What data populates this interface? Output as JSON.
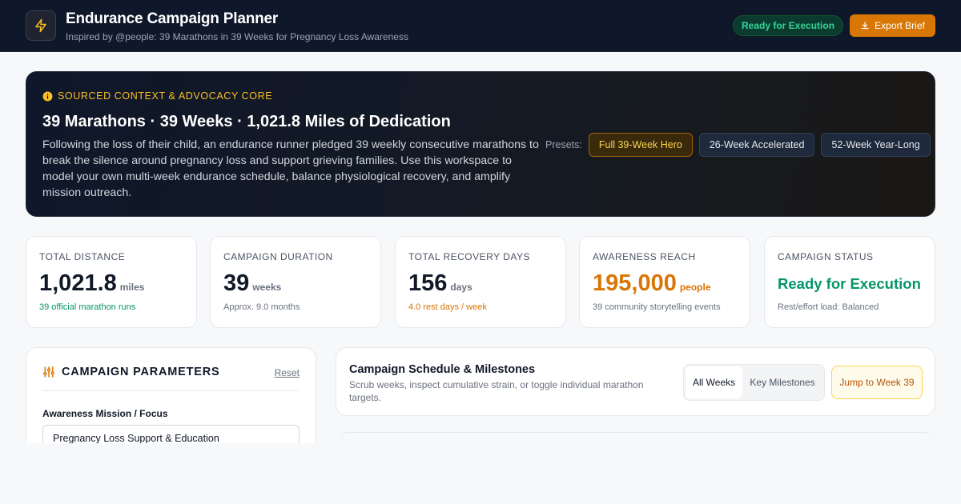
{
  "header": {
    "title": "Endurance Campaign Planner",
    "subtitle": "Inspired by @people: 39 Marathons in 39 Weeks for Pregnancy Loss Awareness",
    "status_badge": "Ready for Execution",
    "export_label": "Export Brief",
    "logo_icon": "lightning-bolt-icon"
  },
  "hero": {
    "tag": "SOURCED CONTEXT & ADVOCACY CORE",
    "title": "39 Marathons · 39 Weeks · 1,021.8 Miles of Dedication",
    "description": "Following the loss of their child, an endurance runner pledged 39 weekly consecutive marathons to break the silence around pregnancy loss and support grieving families. Use this workspace to model your own multi-week endurance schedule, balance physiological recovery, and amplify mission outreach.",
    "presets_label": "Presets:",
    "presets": [
      "Full 39-Week Hero",
      "26-Week Accelerated",
      "52-Week Year-Long"
    ],
    "active_preset": "Full 39-Week Hero"
  },
  "stats": [
    {
      "label": "TOTAL DISTANCE",
      "value": "1,021.8",
      "unit": "miles",
      "note": "39 official marathon runs",
      "value_color": "#111827",
      "note_color": "#059669"
    },
    {
      "label": "CAMPAIGN DURATION",
      "value": "39",
      "unit": "weeks",
      "note": "Approx. 9.0 months",
      "value_color": "#111827",
      "note_color": "#6b7280"
    },
    {
      "label": "TOTAL RECOVERY DAYS",
      "value": "156",
      "unit": "days",
      "note": "4.0 rest days / week",
      "value_color": "#111827",
      "note_color": "#d97706"
    },
    {
      "label": "AWARENESS REACH",
      "value": "195,000",
      "unit": "people",
      "note": "39 community storytelling events",
      "value_color": "#d97706",
      "note_color": "#6b7280"
    },
    {
      "label": "CAMPAIGN STATUS",
      "value": "Ready for Execution",
      "unit": "",
      "note": "Rest/effort load: Balanced",
      "value_color": "#059669",
      "note_color": "#6b7280"
    }
  ],
  "params": {
    "title": "CAMPAIGN PARAMETERS",
    "reset_label": "Reset",
    "mission_label": "Awareness Mission / Focus",
    "mission_value": "Pregnancy Loss Support & Education"
  },
  "schedule": {
    "title": "Campaign Schedule & Milestones",
    "subtitle": "Scrub weeks, inspect cumulative strain, or toggle individual marathon targets.",
    "view_all": "All Weeks",
    "view_key": "Key Milestones",
    "jump_label": "Jump to Week 39"
  },
  "colors": {
    "accent": "#d97706",
    "success": "#059669",
    "header_bg": "#0f172a"
  }
}
